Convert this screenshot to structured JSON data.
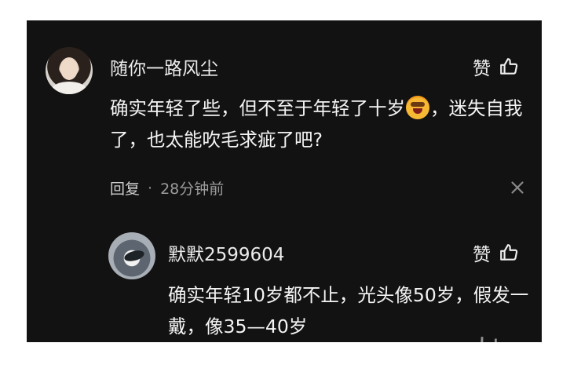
{
  "comments": [
    {
      "username": "随你一路风尘",
      "text_before_emoji": "确实年轻了些，但不至于年轻了十岁",
      "emoji": "laughing-crying-emoji",
      "text_after_emoji": "，迷失自我了，也太能吹毛求疵了吧?",
      "like_label": "赞",
      "reply_label": "回复",
      "separator": "·",
      "time": "28分钟前"
    },
    {
      "username": "默默2599604",
      "text": "确实年轻10岁都不止，光头像50岁，假发一戴，像35—40岁",
      "like_label": "赞"
    }
  ],
  "watermark": "大|",
  "colors": {
    "panel_bg": "#121212",
    "text": "#f4f4f4",
    "meta": "#9c9c9c"
  }
}
